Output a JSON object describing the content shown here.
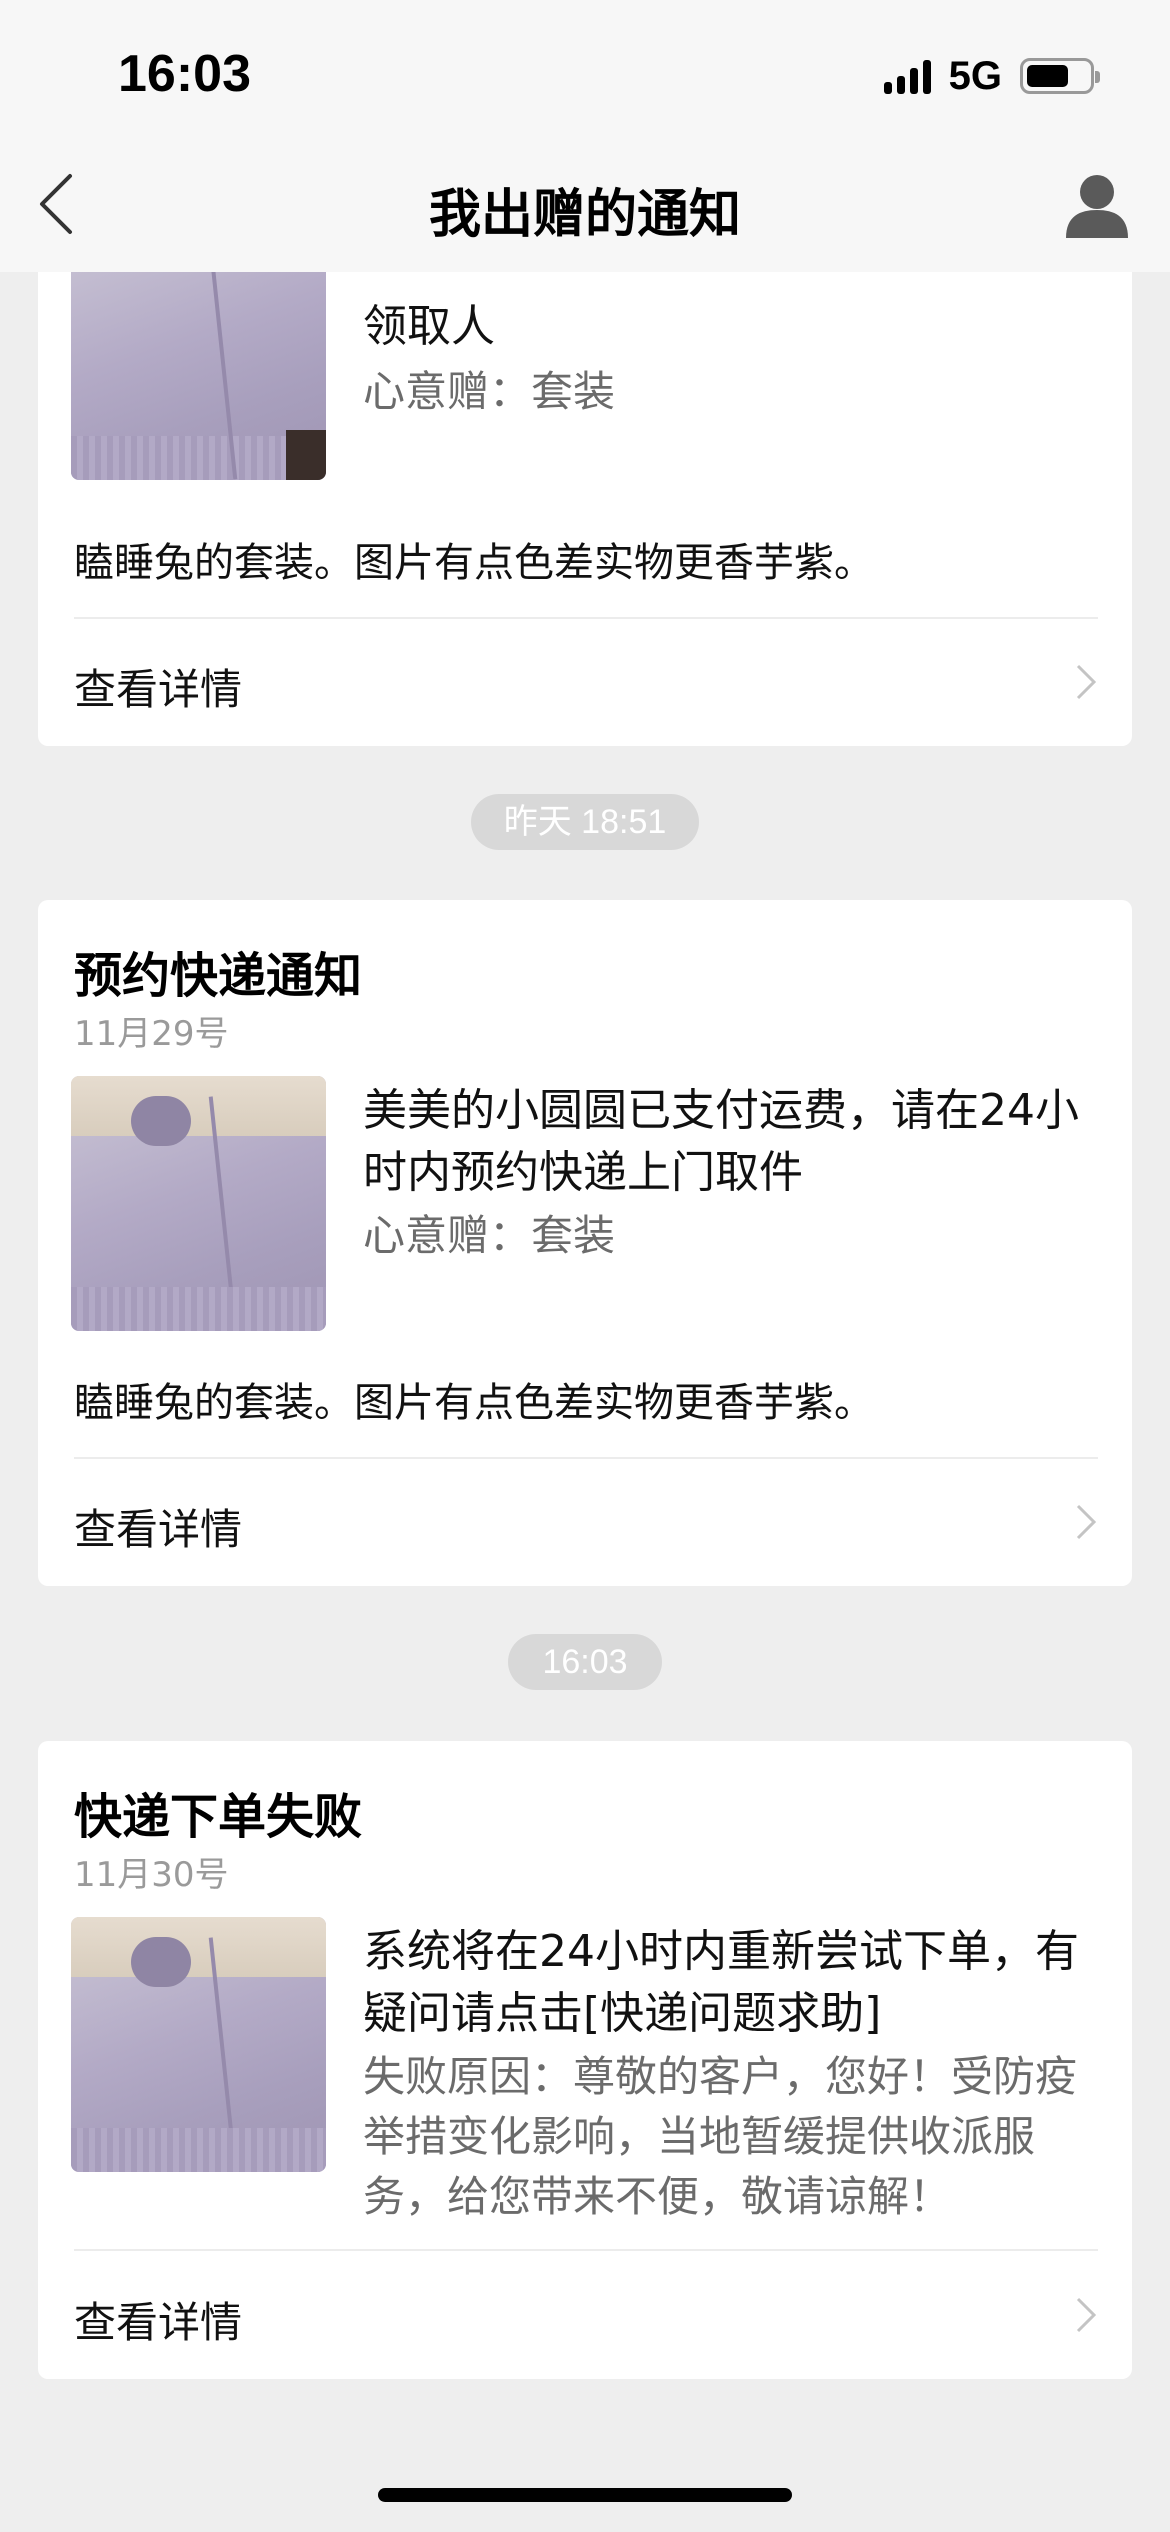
{
  "status_bar": {
    "time": "16:03",
    "network": "5G",
    "battery_level": 0.68
  },
  "nav": {
    "title": "我出赠的通知",
    "back_icon": "back-chevron-icon",
    "profile_icon": "person-icon"
  },
  "cards": [
    {
      "title": "",
      "date": "",
      "message": "美美的小圆圆加入排队，待你选择领取人",
      "message_visible": "领取人",
      "gift": "心意赠：套装",
      "description": "瞌睡兔的套装。图片有点色差实物更香芋紫。",
      "detail_label": "查看详情"
    },
    {
      "title": "预约快递通知",
      "date": "11月29号",
      "message": "美美的小圆圆已支付运费，请在24小时内预约快递上门取件",
      "gift": "心意赠：套装",
      "description": "瞌睡兔的套装。图片有点色差实物更香芋紫。",
      "detail_label": "查看详情"
    },
    {
      "title": "快递下单失败",
      "date": "11月30号",
      "message": "系统将在24小时内重新尝试下单，有疑问请点击[快递问题求助]",
      "reason": "失败原因：尊敬的客户，您好！受防疫举措变化影响，当地暂缓提供收派服务，给您带来不便，敬请谅解！",
      "description": "",
      "detail_label": "查看详情"
    }
  ],
  "timestamps": {
    "before_card_2": "昨天 18:51",
    "before_card_3": "16:03"
  }
}
